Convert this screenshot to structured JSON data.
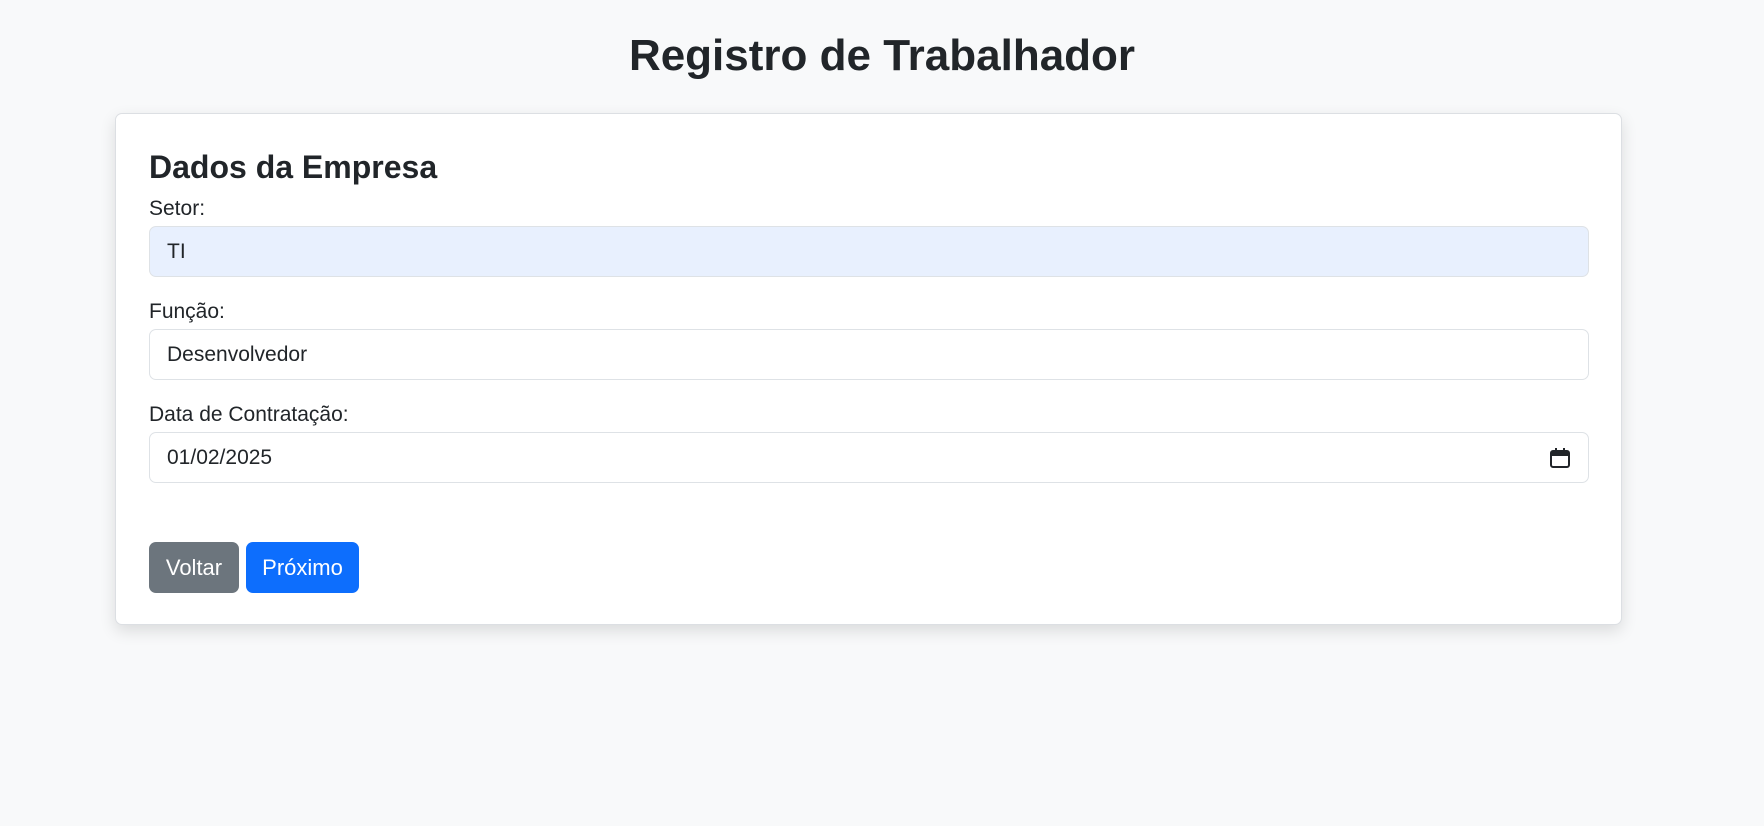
{
  "page": {
    "title": "Registro de Trabalhador"
  },
  "form": {
    "section_title": "Dados da Empresa",
    "fields": [
      {
        "label": "Setor:",
        "value": "TI"
      },
      {
        "label": "Função:",
        "value": "Desenvolvedor"
      },
      {
        "label": "Data de Contratação:",
        "value": "01/02/2025",
        "icon": "calendar-icon"
      }
    ]
  },
  "actions": {
    "back_label": "Voltar",
    "next_label": "Próximo"
  },
  "colors": {
    "background": "#f8f9fa",
    "primary": "#0d6efd",
    "secondary": "#6c757d",
    "autofill": "#e8f0fe"
  }
}
